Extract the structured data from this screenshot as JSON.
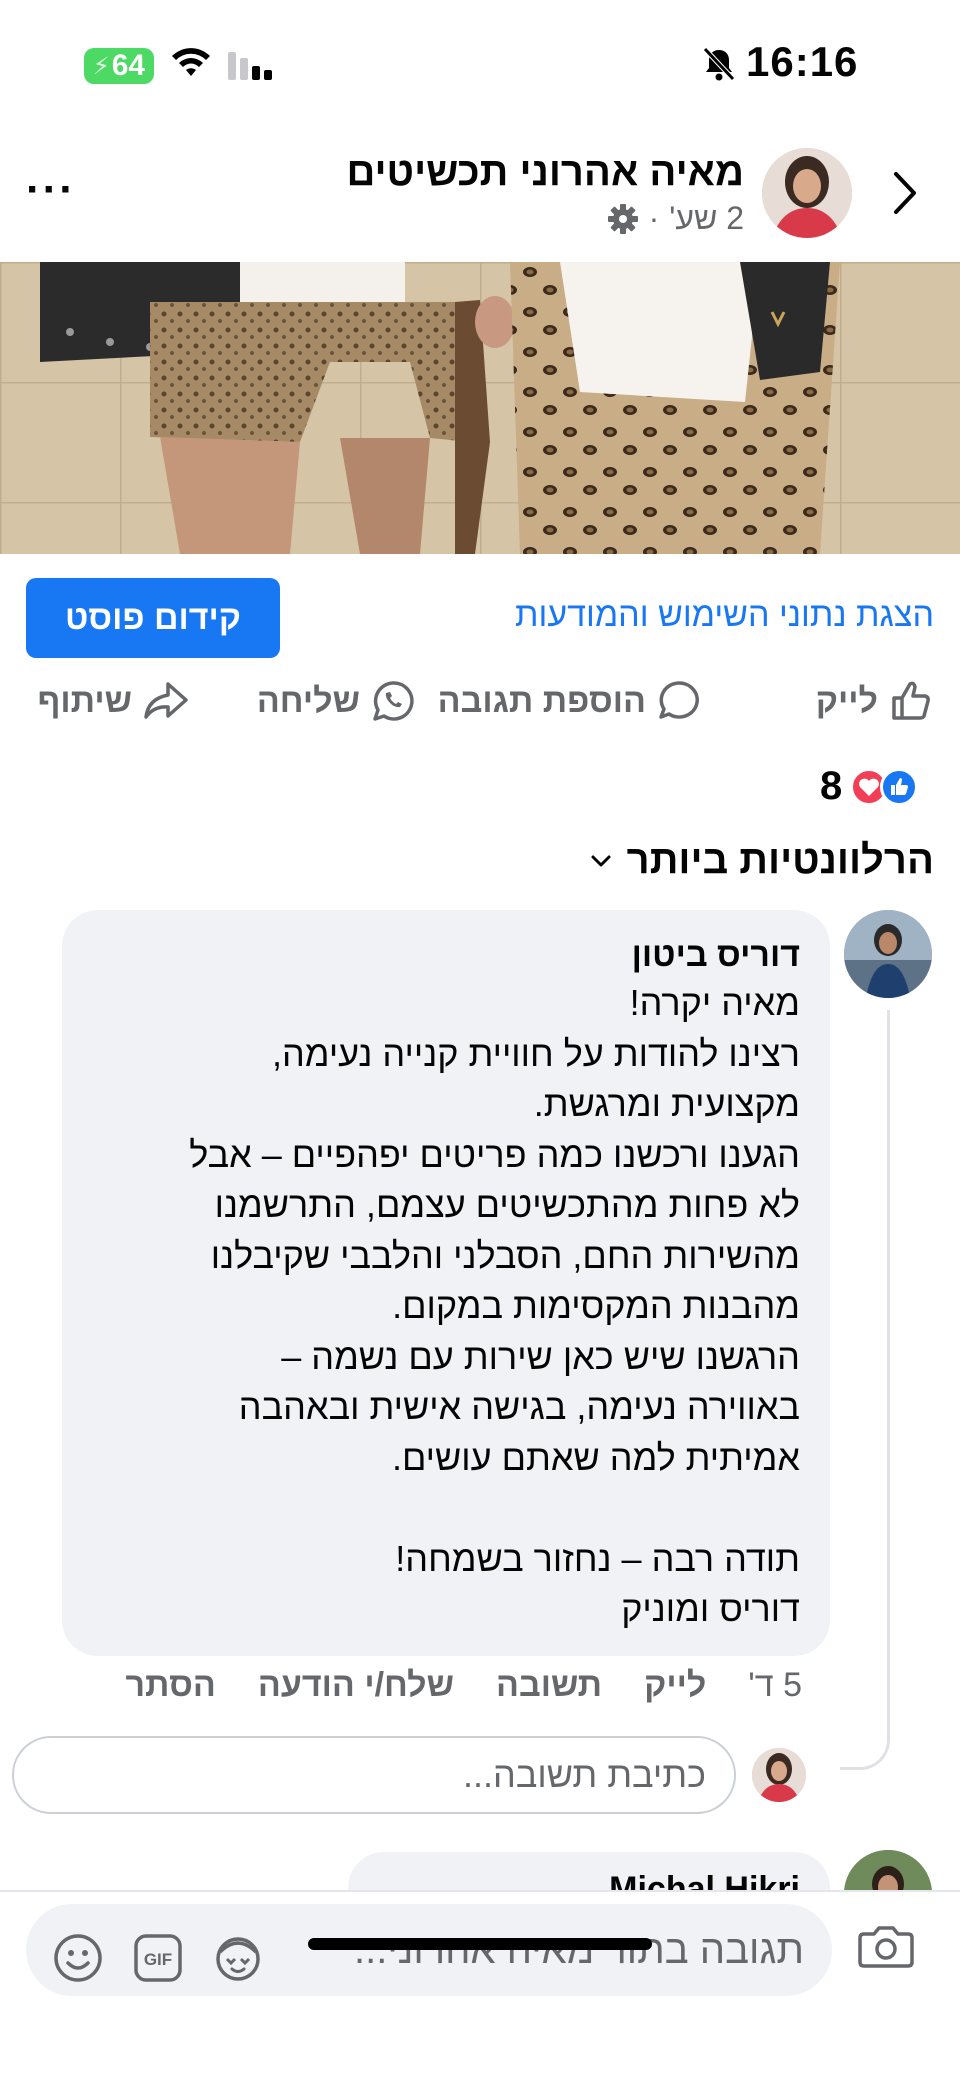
{
  "status_bar": {
    "battery": "64",
    "time": "16:16"
  },
  "header": {
    "title": "מאיה אהרוני תכשיטים",
    "time_ago": "2 שע'",
    "separator": "·"
  },
  "post_actions": {
    "boost_label": "קידום פוסט",
    "insights_label": "הצגת נתוני השימוש והמודעות"
  },
  "action_bar": {
    "like": "לייק",
    "comment": "הוספת תגובה",
    "send": "שליחה",
    "share": "שיתוף"
  },
  "reactions": {
    "count": "8"
  },
  "sort": {
    "label": "הרלוונטיות ביותר"
  },
  "comment": {
    "author": "דוריס ביטון",
    "text": "מאיה יקרה!\nרצינו להודות על חוויית קנייה נעימה,\nמקצועית ומרגשת.\nהגענו ורכשנו כמה פריטים יפהפיים – אבל\nלא פחות מהתכשיטים עצמם, התרשמנו\nמהשירות החם, הסבלני והלבבי שקיבלנו\nמהבנות המקסימות במקום.\nהרגשנו שיש כאן שירות עם נשמה –\nבאווירה נעימה, בגישה אישית ובאהבה\nאמיתית למה שאתם עושים.\n\nתודה רבה – נחזור בשמחה!\nדוריס ומוניק",
    "time": "5 ד'",
    "like": "לייק",
    "reply": "תשובה",
    "send_message": "שלח/י הודעה",
    "hide": "הסתר"
  },
  "reply_box": {
    "placeholder": "כתיבת תשובה..."
  },
  "next_comment": {
    "author": "Michal Hikri"
  },
  "composer": {
    "placeholder": "תגובה בתור מאיה אהרוני..."
  },
  "colors": {
    "accent": "#1877f2",
    "bubble": "#f0f2f5",
    "muted": "#65676b",
    "love": "#f33e58"
  }
}
